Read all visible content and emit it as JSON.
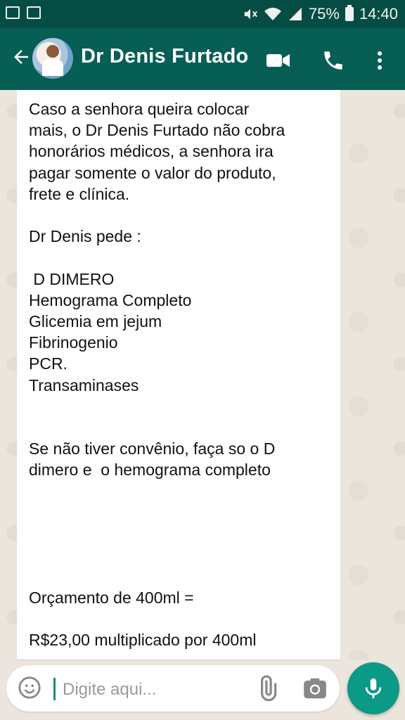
{
  "status_bar": {
    "battery": "75%",
    "time": "14:40",
    "icons": [
      "image-icon",
      "voicemail-icon",
      "mute-icon",
      "wifi-icon",
      "signal-icon",
      "battery-icon"
    ]
  },
  "header": {
    "title": "Dr Denis Furtado",
    "icons": [
      "back-arrow-icon",
      "avatar",
      "video-call-icon",
      "phone-icon",
      "more-vert-icon"
    ]
  },
  "chat": {
    "message_text": "Caso a senhora queira colocar\nmais, o Dr Denis Furtado não cobra\nhonorários médicos, a senhora ira\npagar somente o valor do produto,\nfrete e clínica.\n\nDr Denis pede :\n\n D DIMERO\nHemograma Completo\nGlicemia em jejum\nFibrinogenio\nPCR.\nTransaminases\n\n\nSe não tiver convênio, faça so o D\ndimero e  o hemograma completo\n\n\n\n\n\nOrçamento de 400ml =\n\nR$23,00 multiplicado por 400ml"
  },
  "composer": {
    "placeholder": "Digite aqui...",
    "icons": [
      "emoji-icon",
      "attach-icon",
      "camera-icon",
      "mic-icon"
    ]
  },
  "colors": {
    "status_bar": "#054d44",
    "app_bar": "#075e54",
    "accent": "#0b9a86",
    "chat_bg": "#ece5dd"
  }
}
